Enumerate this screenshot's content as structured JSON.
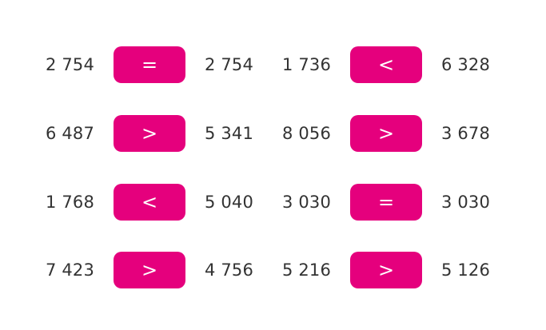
{
  "theme": {
    "button_color": "#e5007d",
    "button_text_color": "#ffffff",
    "number_color": "#333333"
  },
  "rows": [
    {
      "a1": "2 754",
      "op1": "=",
      "b1": "2 754",
      "a2": "1 736",
      "op2": "<",
      "b2": "6 328"
    },
    {
      "a1": "6 487",
      "op1": ">",
      "b1": "5 341",
      "a2": "8 056",
      "op2": ">",
      "b2": "3 678"
    },
    {
      "a1": "1 768",
      "op1": "<",
      "b1": "5 040",
      "a2": "3 030",
      "op2": "=",
      "b2": "3 030"
    },
    {
      "a1": "7 423",
      "op1": ">",
      "b1": "4 756",
      "a2": "5 216",
      "op2": ">",
      "b2": "5 126"
    }
  ]
}
